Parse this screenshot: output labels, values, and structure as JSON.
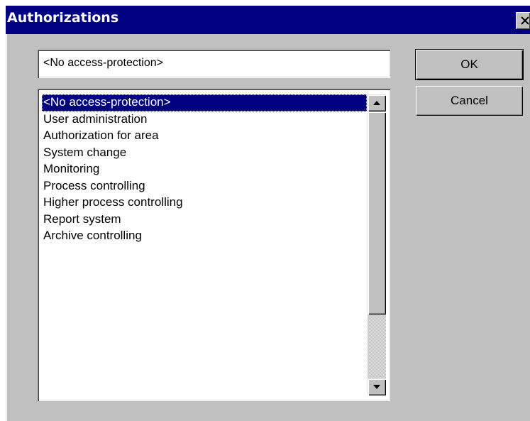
{
  "window": {
    "title": "Authorizations",
    "close_icon": "close-icon"
  },
  "textfield": {
    "value": "<No access-protection>"
  },
  "list": {
    "items": [
      "<No access-protection>",
      "User administration",
      "Authorization for area",
      "System change",
      "Monitoring",
      "Process controlling",
      "Higher process controlling",
      "Report system",
      "Archive controlling"
    ],
    "selected_index": 0
  },
  "buttons": {
    "ok_label": "OK",
    "cancel_label": "Cancel"
  },
  "colors": {
    "titlebar": "#000080",
    "dialog_face": "#c0c0c0",
    "selection": "#000080"
  }
}
